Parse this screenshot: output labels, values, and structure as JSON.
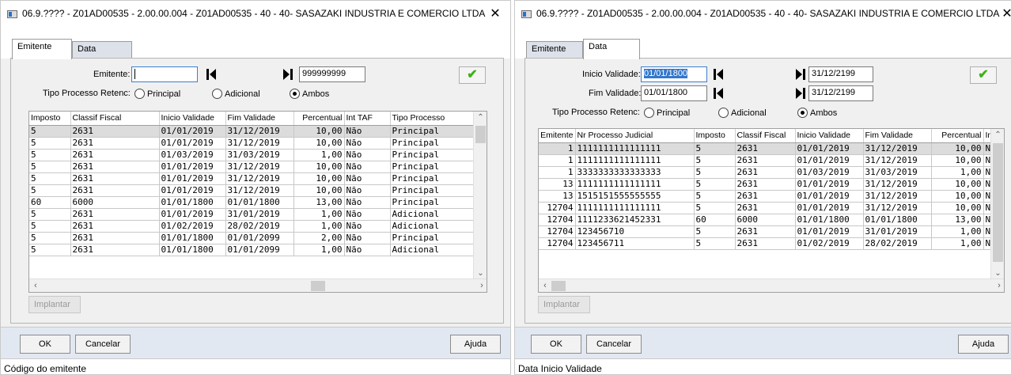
{
  "window1": {
    "title": "06.9.???? - Z01AD00535 - 2.00.00.004 - Z01AD00535 - 40 - 40- SASAZAKI INDUSTRIA E COMERCIO LTDA",
    "close": "✕",
    "tabs": [
      "Emitente",
      "Data"
    ],
    "emitente_label": "Emitente:",
    "emitente_from": "",
    "emitente_to": "999999999",
    "confirm_icon": "checkmark-icon",
    "tipo_label": "Tipo Processo Retenc:",
    "radio_options": [
      "Principal",
      "Adicional",
      "Ambos"
    ],
    "radio_selected": "Ambos",
    "columns": [
      "Imposto",
      "Classif Fiscal",
      "Inicio Validade",
      "Fim Validade",
      "Percentual",
      "Int TAF",
      "Tipo Processo"
    ],
    "rows": [
      [
        "5",
        "2631",
        "01/01/2019",
        "31/12/2019",
        "10,00",
        "Não",
        "Principal"
      ],
      [
        "5",
        "2631",
        "01/01/2019",
        "31/12/2019",
        "10,00",
        "Não",
        "Principal"
      ],
      [
        "5",
        "2631",
        "01/03/2019",
        "31/03/2019",
        "1,00",
        "Não",
        "Principal"
      ],
      [
        "5",
        "2631",
        "01/01/2019",
        "31/12/2019",
        "10,00",
        "Não",
        "Principal"
      ],
      [
        "5",
        "2631",
        "01/01/2019",
        "31/12/2019",
        "10,00",
        "Não",
        "Principal"
      ],
      [
        "5",
        "2631",
        "01/01/2019",
        "31/12/2019",
        "10,00",
        "Não",
        "Principal"
      ],
      [
        "60",
        "6000",
        "01/01/1800",
        "01/01/1800",
        "13,00",
        "Não",
        "Principal"
      ],
      [
        "5",
        "2631",
        "01/01/2019",
        "31/01/2019",
        "1,00",
        "Não",
        "Adicional"
      ],
      [
        "5",
        "2631",
        "01/02/2019",
        "28/02/2019",
        "1,00",
        "Não",
        "Adicional"
      ],
      [
        "5",
        "2631",
        "01/01/1800",
        "01/01/2099",
        "2,00",
        "Não",
        "Principal"
      ],
      [
        "5",
        "2631",
        "01/01/1800",
        "01/01/2099",
        "1,00",
        "Não",
        "Adicional"
      ]
    ],
    "implantar": "Implantar",
    "ok": "OK",
    "cancelar": "Cancelar",
    "ajuda": "Ajuda",
    "status": "Código do emitente"
  },
  "window2": {
    "title": "06.9.???? - Z01AD00535 - 2.00.00.004 - Z01AD00535 - 40 - 40- SASAZAKI INDUSTRIA E COMERCIO LTDA",
    "close": "✕",
    "tabs": [
      "Emitente",
      "Data"
    ],
    "inicio_label": "Inicio Validade:",
    "inicio_from": "01/01/1800",
    "inicio_to": "31/12/2199",
    "fim_label": "Fim Validade:",
    "fim_from": "01/01/1800",
    "fim_to": "31/12/2199",
    "confirm_icon": "checkmark-icon",
    "tipo_label": "Tipo Processo Retenc:",
    "radio_options": [
      "Principal",
      "Adicional",
      "Ambos"
    ],
    "radio_selected": "Ambos",
    "columns": [
      "Emitente",
      "Nr Processo Judicial",
      "Imposto",
      "Classif Fiscal",
      "Inicio Validade",
      "Fim Validade",
      "Percentual",
      "In"
    ],
    "rows": [
      [
        "1",
        "1111111111111111",
        "5",
        "2631",
        "01/01/2019",
        "31/12/2019",
        "10,00",
        "N"
      ],
      [
        "1",
        "1111111111111111",
        "5",
        "2631",
        "01/01/2019",
        "31/12/2019",
        "10,00",
        "N"
      ],
      [
        "1",
        "3333333333333333",
        "5",
        "2631",
        "01/03/2019",
        "31/03/2019",
        "1,00",
        "N"
      ],
      [
        "13",
        "1111111111111111",
        "5",
        "2631",
        "01/01/2019",
        "31/12/2019",
        "10,00",
        "N"
      ],
      [
        "13",
        "1515151555555555",
        "5",
        "2631",
        "01/01/2019",
        "31/12/2019",
        "10,00",
        "N"
      ],
      [
        "12704",
        "1111111111111111",
        "5",
        "2631",
        "01/01/2019",
        "31/12/2019",
        "10,00",
        "N"
      ],
      [
        "12704",
        "1111233621452331",
        "60",
        "6000",
        "01/01/1800",
        "01/01/1800",
        "13,00",
        "N"
      ],
      [
        "12704",
        "123456710",
        "5",
        "2631",
        "01/01/2019",
        "31/01/2019",
        "1,00",
        "N"
      ],
      [
        "12704",
        "123456711",
        "5",
        "2631",
        "01/02/2019",
        "28/02/2019",
        "1,00",
        "N"
      ]
    ],
    "implantar": "Implantar",
    "ok": "OK",
    "cancelar": "Cancelar",
    "ajuda": "Ajuda",
    "status": "Data Inicio Validade"
  }
}
